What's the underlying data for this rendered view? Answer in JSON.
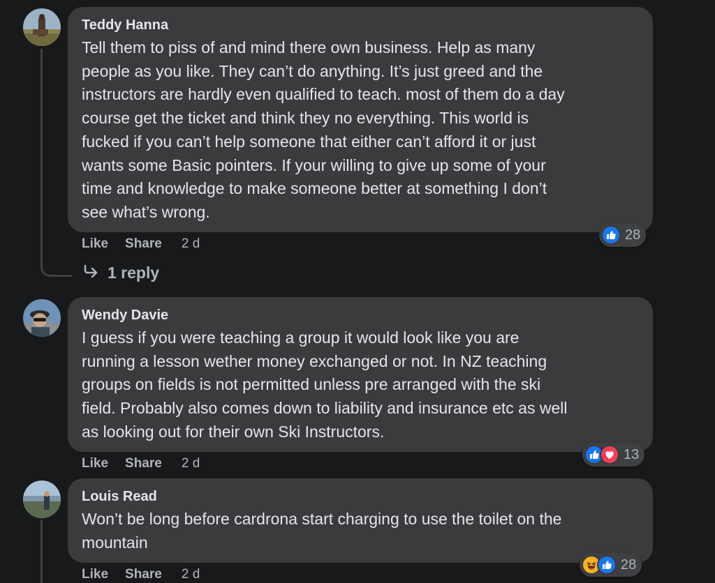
{
  "colors": {
    "background": "#18191a",
    "bubble": "#3a3b3c",
    "text": "#e4e6eb",
    "secondary_text": "#b0b3b8",
    "like_blue": "#1877f2",
    "love_red": "#f33e58",
    "haha_yellow": "#f7b125"
  },
  "comments": [
    {
      "author": "Teddy Hanna",
      "text": "Tell them to piss of and mind there own business. Help as many\npeople as you like. They can’t do anything. It’s just greed and the\ninstructors are hardly even qualified to teach. most of them do a day\ncourse get the ticket and think they no everything. This world is\nfucked if you can’t help someone that either can’t afford it or just\nwants some Basic pointers. If your willing to give up some of your\ntime and knowledge to make someone better at something I don’t\nsee what’s wrong.",
      "like_label": "Like",
      "share_label": "Share",
      "time": "2 d",
      "reactions": [
        "like-icon"
      ],
      "reaction_count": "28",
      "replies_label": "1 reply"
    },
    {
      "author": "Wendy Davie",
      "text": "I guess if you were teaching a group it would look like you are\nrunning a lesson wether money exchanged or not. In NZ teaching\ngroups on fields is not permitted unless pre arranged with the ski\nfield. Probably also comes down to liability and insurance etc as well\nas looking out for their own Ski Instructors.",
      "like_label": "Like",
      "share_label": "Share",
      "time": "2 d",
      "reactions": [
        "like-icon",
        "love-icon"
      ],
      "reaction_count": "13"
    },
    {
      "author": "Louis Read",
      "text": "Won’t be long before cardrona start charging to use the toilet on the\nmountain",
      "like_label": "Like",
      "share_label": "Share",
      "time": "2 d",
      "reactions": [
        "haha-icon",
        "like-icon"
      ],
      "reaction_count": "28"
    }
  ]
}
